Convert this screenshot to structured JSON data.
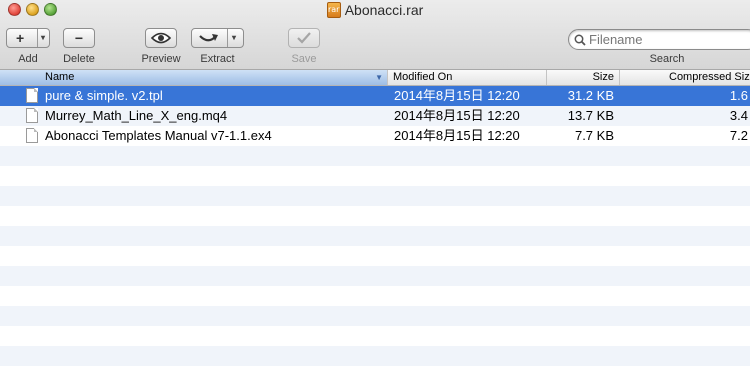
{
  "window": {
    "title": "Abonacci.rar",
    "title_icon_label": "rar"
  },
  "toolbar": {
    "add_label": "Add",
    "add_glyph": "+",
    "delete_label": "Delete",
    "delete_glyph": "−",
    "preview_label": "Preview",
    "extract_label": "Extract",
    "save_label": "Save",
    "dropdown_glyph": "▾"
  },
  "search": {
    "placeholder": "Filename",
    "label": "Search"
  },
  "columns": {
    "name": "Name",
    "modified": "Modified On",
    "size": "Size",
    "compressed": "Compressed Size"
  },
  "sort": {
    "column": "name",
    "indicator": "▼"
  },
  "files": [
    {
      "name": "pure & simple. v2.tpl",
      "modified": "2014年8月15日 12:20",
      "size": "31.2 KB",
      "compressed": "1.6",
      "selected": true
    },
    {
      "name": "Murrey_Math_Line_X_eng.mq4",
      "modified": "2014年8月15日 12:20",
      "size": "13.7 KB",
      "compressed": "3.4",
      "selected": false
    },
    {
      "name": "Abonacci Templates Manual v7-1.1.ex4",
      "modified": "2014年8月15日 12:20",
      "size": "7.7 KB",
      "compressed": "7.2",
      "selected": false
    }
  ],
  "colors": {
    "selection": "#3875d7",
    "stripe": "#f0f4fa"
  }
}
